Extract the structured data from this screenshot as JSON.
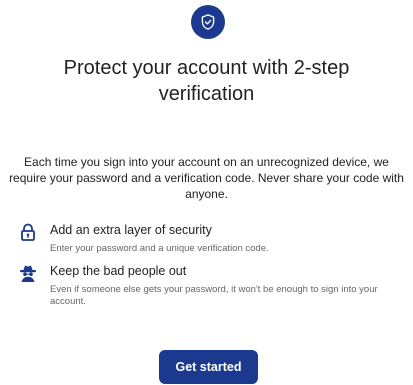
{
  "header": {
    "icon": "shield-check-icon",
    "title": "Protect your account with 2-step verification",
    "accent_color": "#1b3a8f"
  },
  "intro": "Each time you sign into your account on an unrecognized device, we require your password and a verification code. Never share your code with anyone.",
  "features": [
    {
      "icon": "padlock-icon",
      "title": "Add an extra layer of security",
      "description": "Enter your password and a unique verification code."
    },
    {
      "icon": "spy-icon",
      "title": "Keep the bad people out",
      "description": "Even if someone else gets your password, it won't be enough to sign into your account."
    }
  ],
  "cta": {
    "label": "Get started"
  }
}
